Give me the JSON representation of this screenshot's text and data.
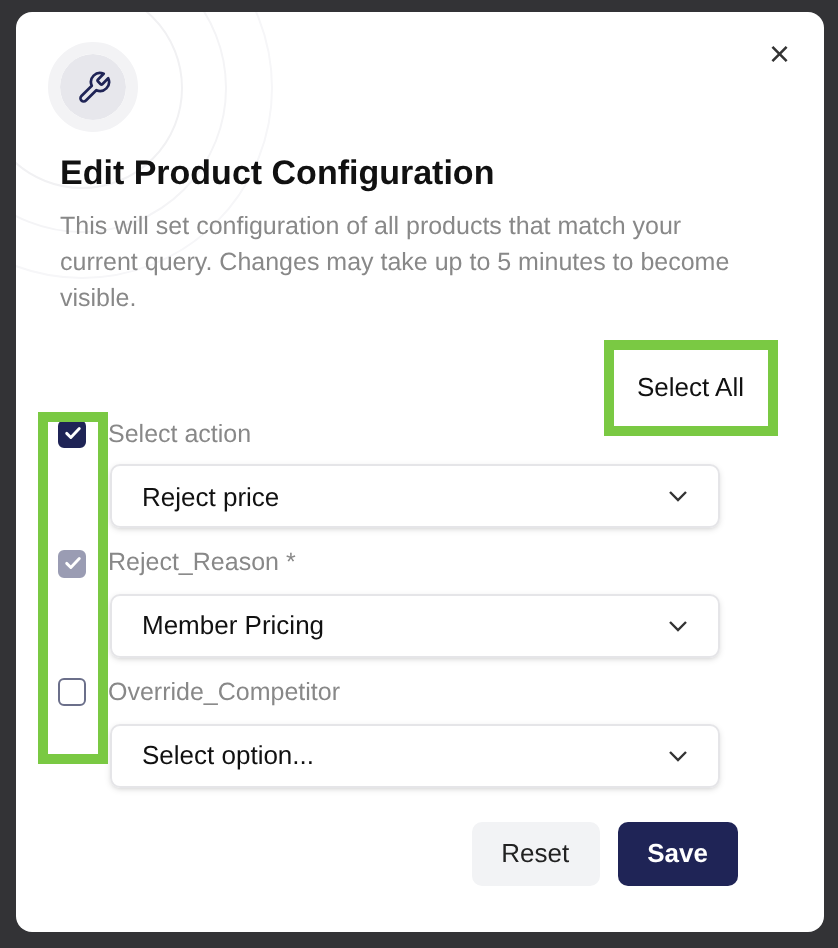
{
  "dialog": {
    "title": "Edit Product Configuration",
    "description": "This will set configuration of all products that match your current query. Changes may take up to 5 minutes to become visible.",
    "close": "×"
  },
  "select_all": {
    "label": "Select All",
    "highlighted": true
  },
  "checkbox_column_highlighted": true,
  "fields": [
    {
      "label": "Select action",
      "value": "Reject price",
      "checked": true,
      "disabled": false
    },
    {
      "label": "Reject_Reason *",
      "value": "Member Pricing",
      "checked": true,
      "disabled": true
    },
    {
      "label": "Override_Competitor",
      "value": "Select option...",
      "checked": false,
      "disabled": false
    }
  ],
  "buttons": [
    {
      "label": "Reset",
      "kind": "secondary"
    },
    {
      "label": "Save",
      "kind": "primary"
    }
  ]
}
